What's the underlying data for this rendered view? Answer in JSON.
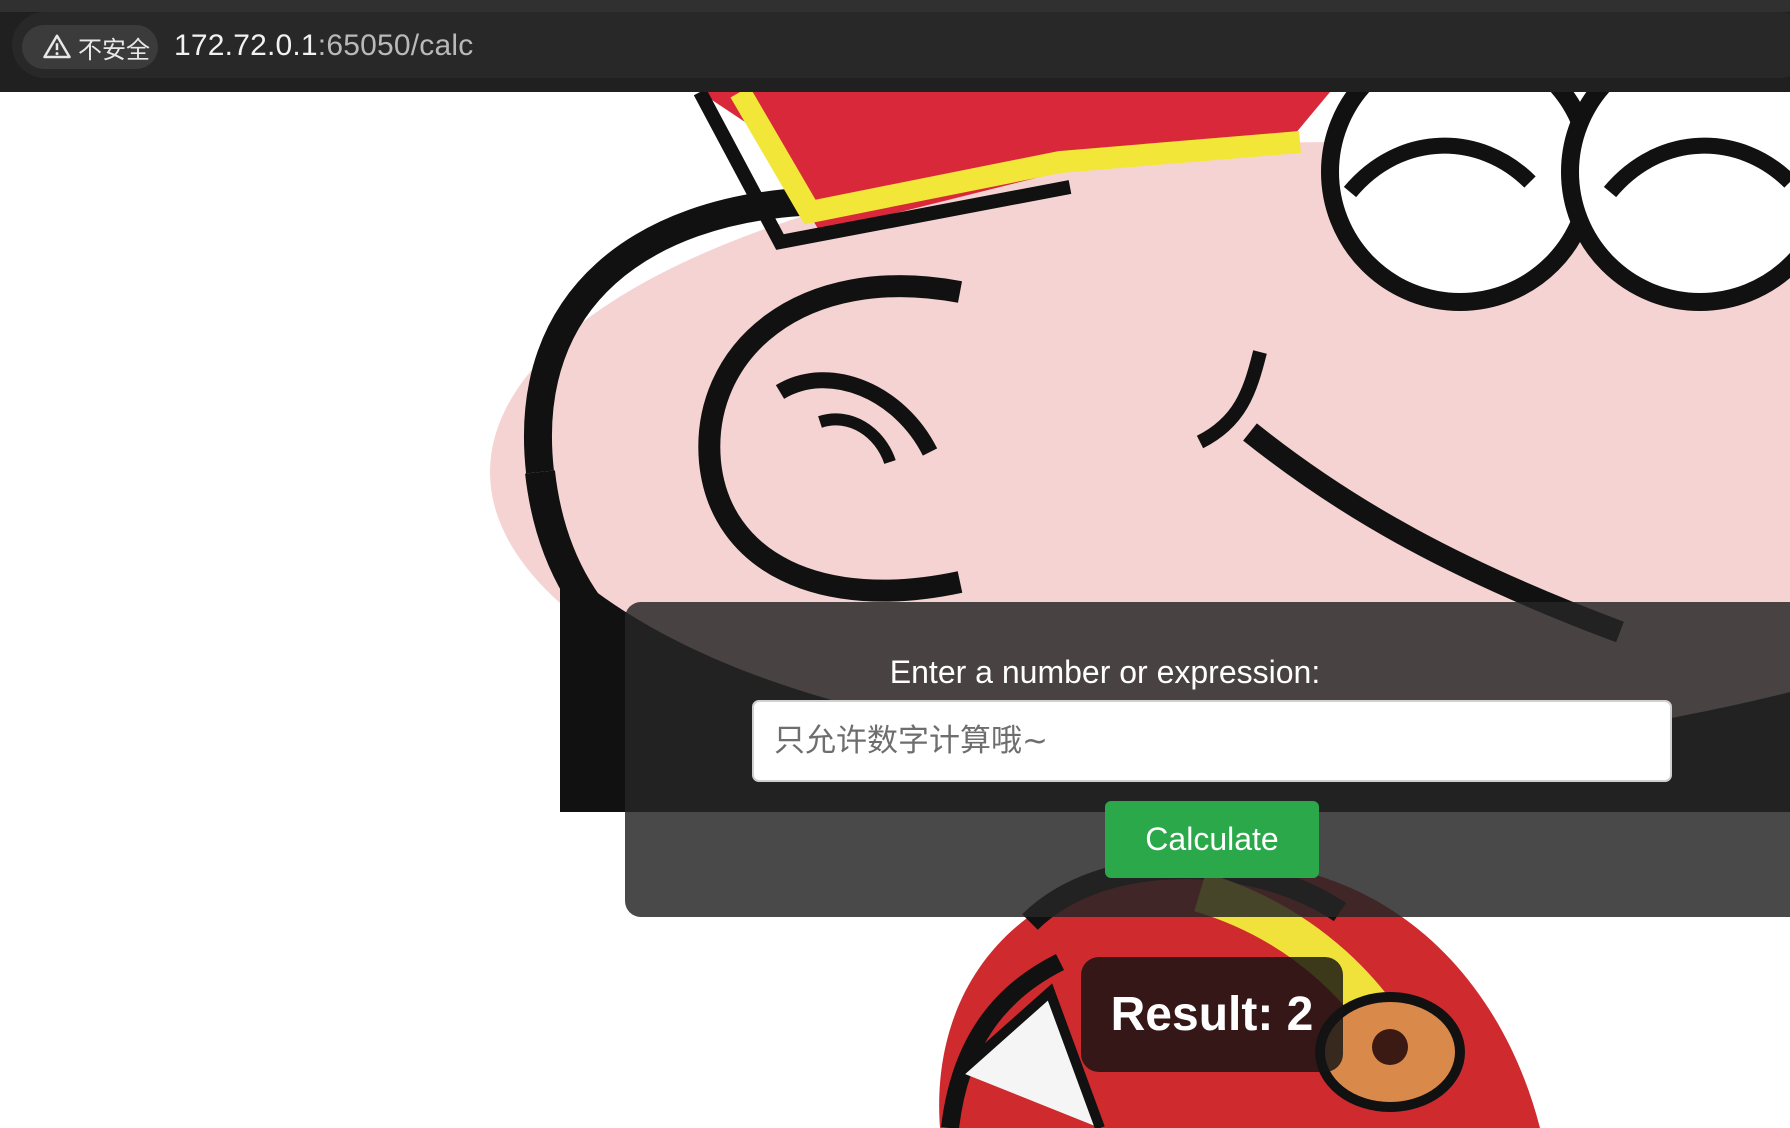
{
  "browser": {
    "security_label": "不安全",
    "url_host": "172.72.0.1",
    "url_rest": ":65050/calc"
  },
  "calculator": {
    "label": "Enter a number or expression:",
    "input_value": "",
    "input_placeholder": "只允许数字计算哦~",
    "button_label": "Calculate",
    "result_text": "Result: 2"
  },
  "colors": {
    "button": "#2aa84a",
    "panel": "#3a3a3a"
  }
}
